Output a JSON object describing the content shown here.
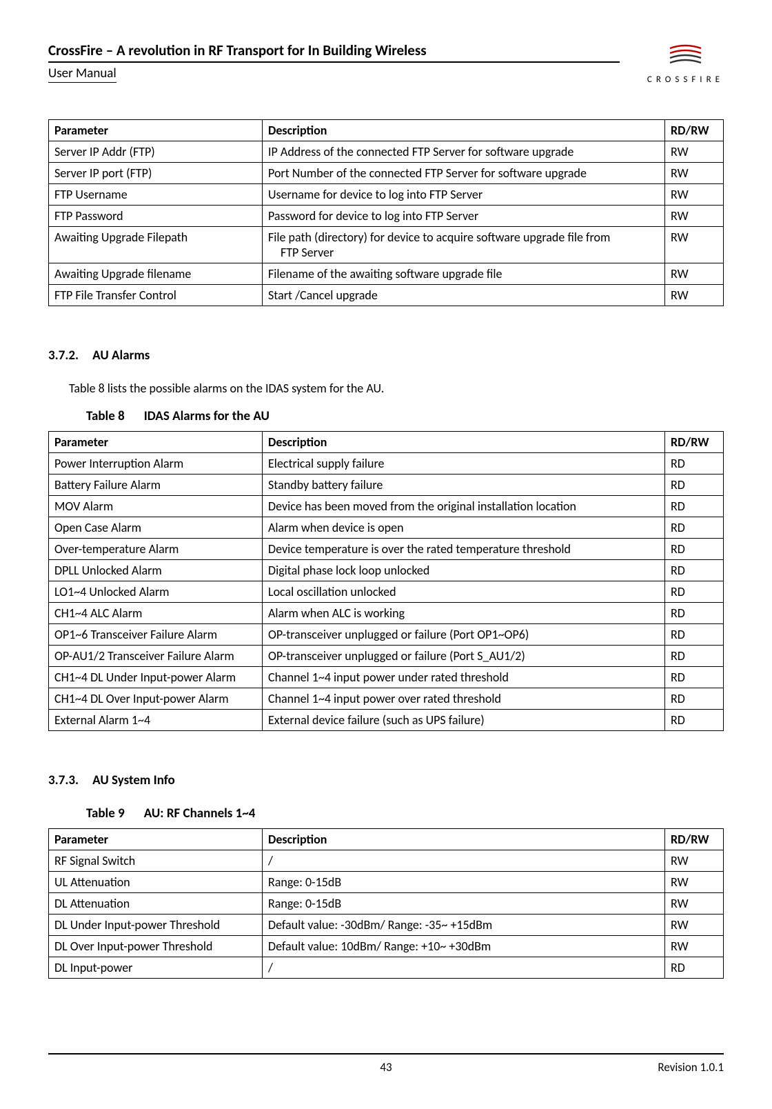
{
  "header": {
    "title": "CrossFire – A revolution in RF Transport for In Building Wireless",
    "subtitle": "User Manual",
    "logo_text": "CROSSFIRE"
  },
  "table1": {
    "headers": [
      "Parameter",
      "Description",
      "RD/RW"
    ],
    "rows": [
      {
        "param": "Server IP Addr (FTP)",
        "desc": "IP Address of the connected FTP Server for software upgrade",
        "rdrw": "RW"
      },
      {
        "param": "Server IP port (FTP)",
        "desc": "Port Number of the connected FTP Server for software upgrade",
        "rdrw": "RW"
      },
      {
        "param": "FTP Username",
        "desc": "Username for device to log into FTP Server",
        "rdrw": "RW"
      },
      {
        "param": "FTP Password",
        "desc": "Password for device to log into FTP Server",
        "rdrw": "RW"
      },
      {
        "param": "Awaiting Upgrade Filepath",
        "desc": "File path (directory) for device to acquire software upgrade file from",
        "desc2": "FTP Server",
        "rdrw": "RW"
      },
      {
        "param": "Awaiting Upgrade filename",
        "desc": "Filename of the awaiting software upgrade file",
        "rdrw": "RW"
      },
      {
        "param": "FTP File Transfer Control",
        "desc": "Start /Cancel upgrade",
        "rdrw": "RW"
      }
    ]
  },
  "section372": {
    "num": "3.7.2.",
    "title": "AU Alarms",
    "text": "Table 8 lists the possible alarms on the IDAS system for the AU.",
    "table_num": "Table 8",
    "table_title": "IDAS Alarms for the AU"
  },
  "table2": {
    "headers": [
      "Parameter",
      "Description",
      "RD/RW"
    ],
    "rows": [
      {
        "param": "Power Interruption Alarm",
        "desc": "Electrical supply failure",
        "rdrw": "RD"
      },
      {
        "param": "Battery Failure Alarm",
        "desc": "Standby battery failure",
        "rdrw": "RD"
      },
      {
        "param": "MOV Alarm",
        "desc": "Device has been moved from the original installation location",
        "rdrw": "RD"
      },
      {
        "param": "Open Case Alarm",
        "desc": "Alarm when device is open",
        "rdrw": "RD"
      },
      {
        "param": "Over-temperature Alarm",
        "desc": "Device temperature is over the rated temperature threshold",
        "rdrw": "RD"
      },
      {
        "param": "DPLL Unlocked Alarm",
        "desc": "Digital phase lock loop unlocked",
        "rdrw": "RD"
      },
      {
        "param": "LO1~4 Unlocked Alarm",
        "desc": "Local oscillation unlocked",
        "rdrw": "RD"
      },
      {
        "param": "CH1~4 ALC Alarm",
        "desc": "Alarm when ALC is working",
        "rdrw": "RD"
      },
      {
        "param": "OP1~6 Transceiver Failure Alarm",
        "desc": "OP-transceiver unplugged or failure (Port OP1~OP6)",
        "rdrw": "RD"
      },
      {
        "param": "OP-AU1/2 Transceiver Failure Alarm",
        "desc": "OP-transceiver unplugged or failure (Port S_AU1/2)",
        "rdrw": "RD"
      },
      {
        "param": "CH1~4 DL Under Input-power Alarm",
        "desc": "Channel 1~4 input power under rated threshold",
        "rdrw": "RD"
      },
      {
        "param": "CH1~4 DL Over Input-power Alarm",
        "desc": "Channel 1~4 input power over rated threshold",
        "rdrw": "RD"
      },
      {
        "param": "External Alarm 1~4",
        "desc": "External device failure (such as UPS failure)",
        "rdrw": "RD"
      }
    ]
  },
  "section373": {
    "num": "3.7.3.",
    "title": "AU System Info",
    "table_num": "Table 9",
    "table_title": "AU: RF Channels 1~4"
  },
  "table3": {
    "headers": [
      "Parameter",
      "Description",
      "RD/RW"
    ],
    "rows": [
      {
        "param": "RF Signal Switch",
        "desc": "/",
        "rdrw": "RW"
      },
      {
        "param": "UL Attenuation",
        "desc": "Range: 0-15dB",
        "rdrw": "RW"
      },
      {
        "param": "DL Attenuation",
        "desc": "Range: 0-15dB",
        "rdrw": "RW"
      },
      {
        "param": "DL Under Input-power Threshold",
        "desc": "Default value: -30dBm/ Range: -35~ +15dBm",
        "rdrw": "RW"
      },
      {
        "param": "DL Over Input-power Threshold",
        "desc": "Default value: 10dBm/ Range: +10~ +30dBm",
        "rdrw": "RW"
      },
      {
        "param": "DL Input-power",
        "desc": "/",
        "rdrw": "RD"
      }
    ]
  },
  "footer": {
    "page": "43",
    "revision": "Revision 1.0.1"
  }
}
